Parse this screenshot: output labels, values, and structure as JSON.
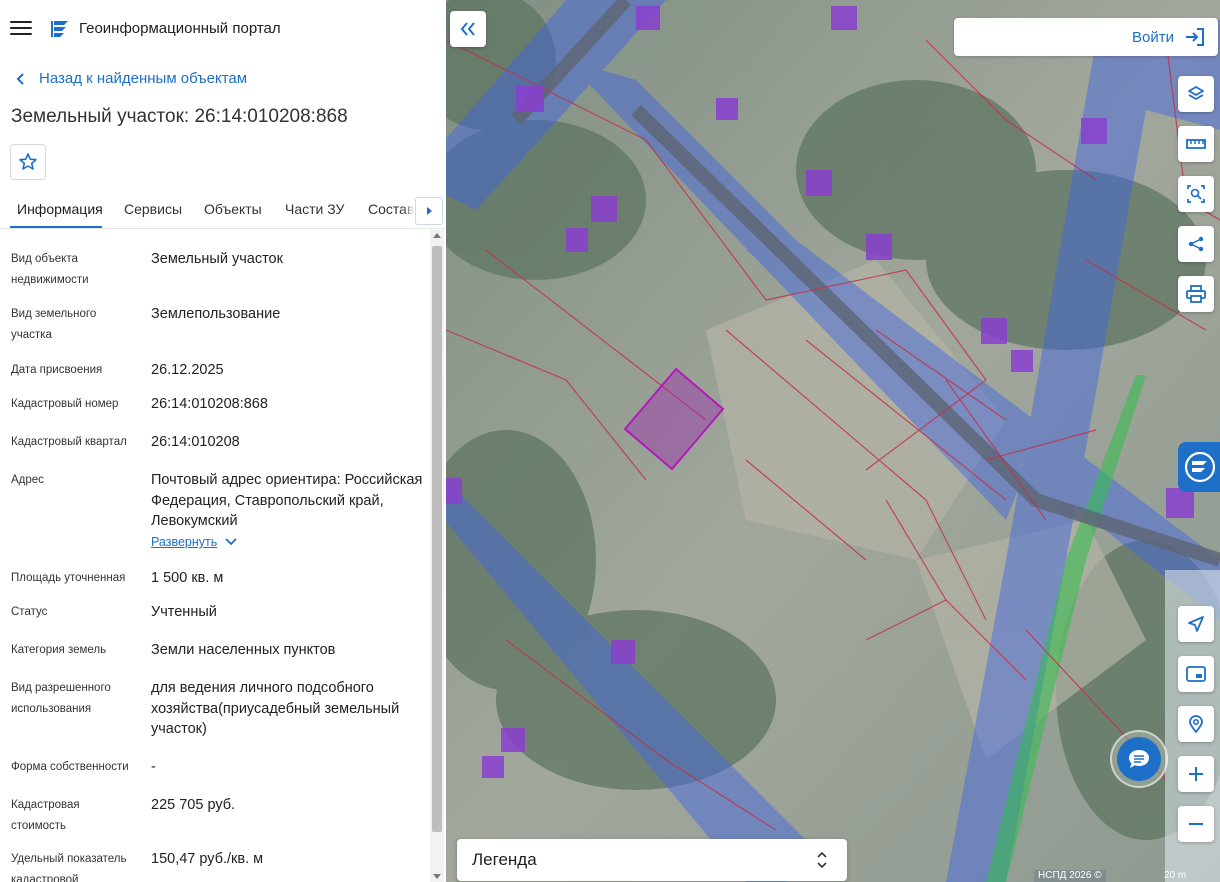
{
  "header": {
    "portal_title": "Геоинформационный портал"
  },
  "navigation": {
    "back_label": "Назад к найденным объектам"
  },
  "parcel": {
    "title": "Земельный участок: 26:14:010208:868"
  },
  "tabs": [
    {
      "label": "Информация",
      "active": true
    },
    {
      "label": "Сервисы"
    },
    {
      "label": "Объекты"
    },
    {
      "label": "Части ЗУ"
    },
    {
      "label": "Состав"
    }
  ],
  "info": {
    "rows": [
      {
        "label": "Вид объекта недвижимости",
        "value": "Земельный участок"
      },
      {
        "label": "Вид земельного участка",
        "value": "Землепользование"
      },
      {
        "label": "Дата присвоения",
        "value": "26.12.2025"
      },
      {
        "label": "Кадастровый номер",
        "value": "26:14:010208:868"
      },
      {
        "label": "Кадастровый квартал",
        "value": "26:14:010208"
      },
      {
        "label": "Адрес",
        "value": "Почтовый адрес ориентира: Российская Федерация, Ставропольский край, Левокумский"
      },
      {
        "label": "Площадь уточненная",
        "value": "1 500 кв. м"
      },
      {
        "label": "Статус",
        "value": "Учтенный"
      },
      {
        "label": "Категория земель",
        "value": "Земли населенных пунктов"
      },
      {
        "label": "Вид разрешенного использования",
        "value": "для ведения личного подсобного хозяйства(приусадебный земельный участок)"
      },
      {
        "label": "Форма собственности",
        "value": "-"
      },
      {
        "label": "Кадастровая стоимость",
        "value": "225 705 руб."
      },
      {
        "label": "Удельный показатель кадастровой",
        "value": "150,47 руб./кв. м"
      }
    ],
    "expand_label": "Развернуть"
  },
  "map": {
    "login_label": "Войти",
    "legend_label": "Легенда",
    "attribution": "НСПД 2026 ©",
    "scale": "20 m"
  },
  "icons": {
    "menu": "menu-icon",
    "logo": "portal-logo-icon",
    "back": "chevron-left-icon",
    "favorite": "star-icon",
    "tabs_next": "caret-right-icon",
    "expand": "chevron-down-icon",
    "collapse": "double-chevron-left-icon",
    "login": "login-icon",
    "layers": "layers-icon",
    "ruler": "ruler-icon",
    "select_area": "area-select-icon",
    "share": "share-icon",
    "print": "printer-icon",
    "locate": "navigation-arrow-icon",
    "minimap": "minimap-icon",
    "geo_search": "location-search-icon",
    "zoom_in": "plus-icon",
    "zoom_out": "minus-icon",
    "chat": "chat-icon",
    "legend_toggle": "chevron-up-down-icon"
  },
  "colors": {
    "accent": "#1e6fc8",
    "selected_parcel": "#9b30b0",
    "buildings": "#8a3fd0",
    "boundaries_red": "#c2334a",
    "zones_blue": "#3d63e6",
    "zones_green": "#2fbf4a"
  }
}
